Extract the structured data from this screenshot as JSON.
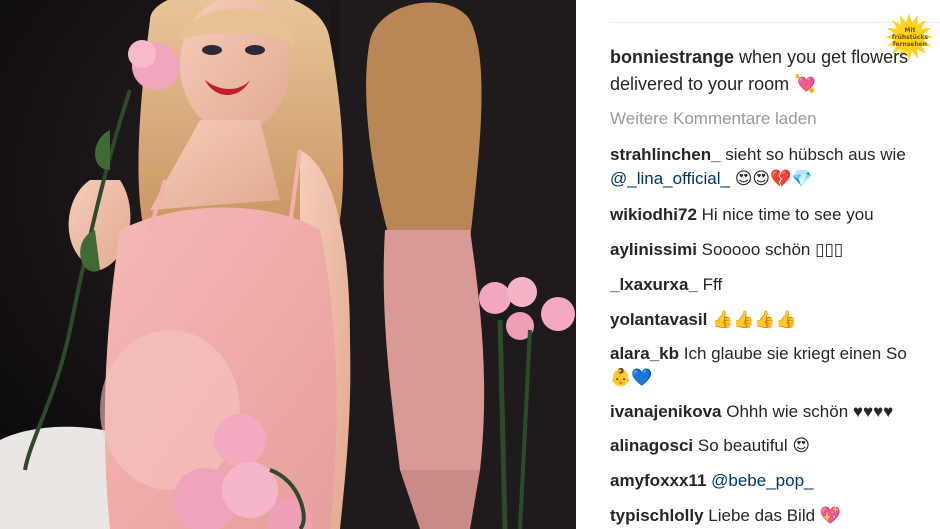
{
  "brand": {
    "logo_line1": "Mit",
    "logo_line2": "frühstücks",
    "logo_line3": "fernsehen",
    "sun_color": "#ffd21e"
  },
  "post": {
    "caption_user": "bonniestrange",
    "caption_text": "when you get flowers",
    "caption_text_line2": "delivered to your room",
    "caption_emoji": "💘",
    "load_more": "Weitere Kommentare laden"
  },
  "comments": [
    {
      "user": "strahlinchen_",
      "text": "sieht so hübsch aus wie",
      "mention": "@_lina_official_",
      "text2": "😍😍💔💎"
    },
    {
      "user": "wikiodhi72",
      "text": "Hi nice time to see you"
    },
    {
      "user": "aylinissimi",
      "text": "Sooooo schön ▯▯▯"
    },
    {
      "user": "_lxaxurxa_",
      "text": "Fff"
    },
    {
      "user": "yolantavasil",
      "text": "👍👍👍👍"
    },
    {
      "user": "alara_kb",
      "text": "Ich glaube sie kriegt einen So",
      "text2": "👶💙"
    },
    {
      "user": "ivanajenikova",
      "text": "Ohhh wie schön ♥♥♥♥"
    },
    {
      "user": "alinagosci",
      "text": "So beautiful 😍"
    },
    {
      "user": "amyfoxxx11",
      "mention": "@bebe_pop_"
    },
    {
      "user": "typischlolly",
      "text": "Liebe das Bild 💖"
    }
  ]
}
